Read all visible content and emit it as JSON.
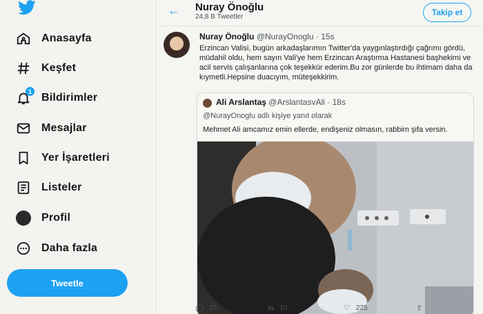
{
  "nav": {
    "items": [
      {
        "label": "Anasayfa",
        "icon": "home-icon"
      },
      {
        "label": "Keşfet",
        "icon": "hashtag-icon"
      },
      {
        "label": "Bildirimler",
        "icon": "bell-icon",
        "badge": "1"
      },
      {
        "label": "Mesajlar",
        "icon": "mail-icon"
      },
      {
        "label": "Yer İşaretleri",
        "icon": "bookmark-icon"
      },
      {
        "label": "Listeler",
        "icon": "list-icon"
      },
      {
        "label": "Profil",
        "icon": "profile-icon"
      },
      {
        "label": "Daha fazla",
        "icon": "more-icon"
      }
    ],
    "tweet_button": "Tweetle"
  },
  "header": {
    "back_icon": "arrow-left-icon",
    "name": "Nuray Önoğlu",
    "tweet_count": "24,8 B Tweetler",
    "follow_button": "Takip et"
  },
  "tweet": {
    "author_name": "Nuray Önoğlu",
    "author_handle": "@NurayOnoglu",
    "time": "· 15s",
    "text": "Erzincan Valisi, bugün arkadaşlarımın Twitter'da yaygınlaştırdığı çağrımı gördü, müdahil oldu, hem sayın Vali'ye hem Erzincan Araştırma Hastanesi başhekimi ve acil servis çalışanlarına çok teşekkür ederim.Bu zor günlerde bu ihtimam daha da kıymetli.Hepsine duacıyım, müteşekkirim.",
    "quote": {
      "author_name": "Ali Arslantaş",
      "author_handle": "@ArslantasvAli",
      "time": "· 18s",
      "reply_to": "@NurayOnoglu adlı kişiye yanıt olarak",
      "text": "Mehmet Ali amcamız emin ellerde, endişeniz olmasın, rabbim şifa versin."
    },
    "actions": {
      "replies": "25",
      "retweets": "10",
      "likes": "225"
    }
  },
  "colors": {
    "accent": "#1da1f2"
  }
}
